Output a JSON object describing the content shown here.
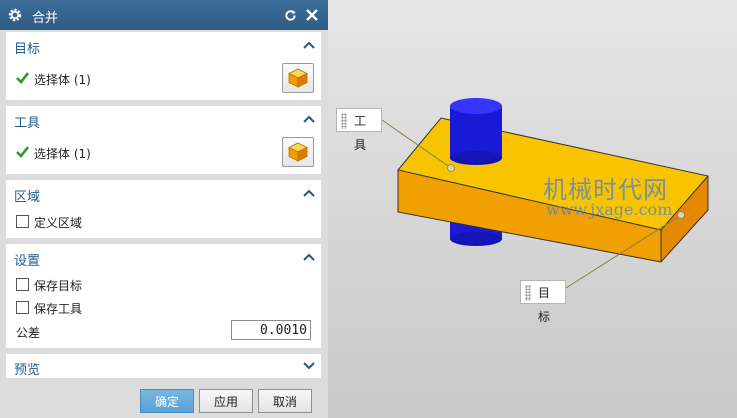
{
  "dialog": {
    "title": "合并",
    "target_section": {
      "header": "目标",
      "item_label": "选择体 (1)"
    },
    "tool_section": {
      "header": "工具",
      "item_label": "选择体 (1)"
    },
    "region_section": {
      "header": "区域",
      "option_label": "定义区域",
      "option_checked": false
    },
    "settings_section": {
      "header": "设置",
      "keep_target_label": "保存目标",
      "keep_target_checked": false,
      "keep_tool_label": "保存工具",
      "keep_tool_checked": false,
      "tolerance_label": "公差",
      "tolerance_value": "0.0010"
    },
    "preview_section": {
      "header": "预览"
    },
    "buttons": {
      "ok": "确定",
      "apply": "应用",
      "cancel": "取消"
    }
  },
  "viewport": {
    "tool_tag": "工具",
    "target_tag": "目标",
    "watermark_line1": "机械时代网",
    "watermark_line2": "www.jxage.com"
  },
  "colors": {
    "titlebar": "#2d5a82",
    "section_header": "#1f5c8a",
    "check_green": "#2a9d2a",
    "block_orange": "#f5b800",
    "cylinder_blue": "#1a1ad6",
    "ok_button": "#5aa2d6"
  }
}
